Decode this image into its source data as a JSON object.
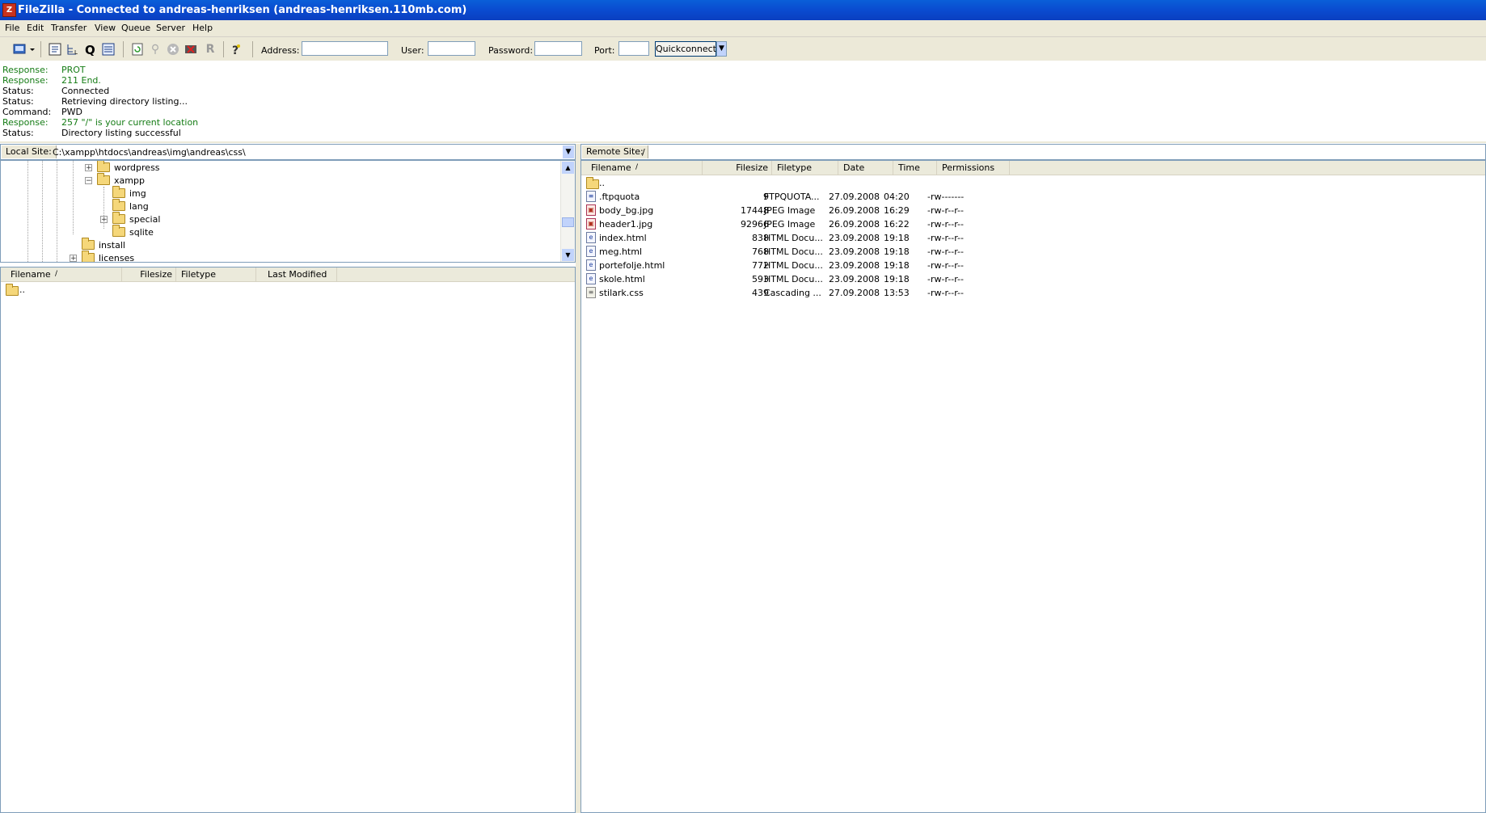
{
  "window": {
    "title": "FileZilla - Connected to andreas-henriksen (andreas-henriksen.110mb.com)",
    "app_icon": "Z"
  },
  "menu": [
    "File",
    "Edit",
    "Transfer",
    "View",
    "Queue",
    "Server",
    "Help"
  ],
  "quickconnect": {
    "address_label": "Address:",
    "address_value": "",
    "user_label": "User:",
    "user_value": "",
    "password_label": "Password:",
    "password_value": "",
    "port_label": "Port:",
    "port_value": "",
    "button_label": "Quickconnect"
  },
  "log": [
    {
      "label": "Response:",
      "message": "PROT",
      "color": "green"
    },
    {
      "label": "Response:",
      "message": "211 End.",
      "color": "green"
    },
    {
      "label": "Status:",
      "message": "Connected",
      "color": "black"
    },
    {
      "label": "Status:",
      "message": "Retrieving directory listing...",
      "color": "black"
    },
    {
      "label": "Command:",
      "message": "PWD",
      "color": "black"
    },
    {
      "label": "Response:",
      "message": "257 \"/\" is your current location",
      "color": "green"
    },
    {
      "label": "Status:",
      "message": "Directory listing successful",
      "color": "black"
    }
  ],
  "local": {
    "label": "Local Site:",
    "path": "C:\\xampp\\htdocs\\andreas\\img\\andreas\\css\\",
    "tree": [
      {
        "name": "wordpress",
        "expander": "+"
      },
      {
        "name": "xampp",
        "expander": "−"
      },
      {
        "name": "img",
        "expander": ""
      },
      {
        "name": "lang",
        "expander": ""
      },
      {
        "name": "special",
        "expander": "+"
      },
      {
        "name": "sqlite",
        "expander": ""
      },
      {
        "name": "install",
        "expander": ""
      },
      {
        "name": "licenses",
        "expander": "+"
      }
    ],
    "columns": [
      "Filename",
      "Filesize",
      "Filetype",
      "Last Modified"
    ],
    "sort_indicator": "/",
    "files": [
      {
        "name": ".."
      }
    ]
  },
  "remote": {
    "label": "Remote Site:",
    "path": "/",
    "columns": [
      "Filename",
      "Filesize",
      "Filetype",
      "Date",
      "Time",
      "Permissions"
    ],
    "sort_indicator": "/",
    "files": [
      {
        "name": "..",
        "size": "",
        "type": "",
        "date": "",
        "time": "",
        "perm": "",
        "icon": "folder"
      },
      {
        "name": ".ftpquota",
        "size": "9",
        "type": "FTPQUOTA...",
        "date": "27.09.2008",
        "time": "04:20",
        "perm": "-rw-------",
        "icon": "doc"
      },
      {
        "name": "body_bg.jpg",
        "size": "17448",
        "type": "JPEG Image",
        "date": "26.09.2008",
        "time": "16:29",
        "perm": "-rw-r--r--",
        "icon": "img"
      },
      {
        "name": "header1.jpg",
        "size": "92966",
        "type": "JPEG Image",
        "date": "26.09.2008",
        "time": "16:22",
        "perm": "-rw-r--r--",
        "icon": "img"
      },
      {
        "name": "index.html",
        "size": "838",
        "type": "HTML Docu...",
        "date": "23.09.2008",
        "time": "19:18",
        "perm": "-rw-r--r--",
        "icon": "html"
      },
      {
        "name": "meg.html",
        "size": "768",
        "type": "HTML Docu...",
        "date": "23.09.2008",
        "time": "19:18",
        "perm": "-rw-r--r--",
        "icon": "html"
      },
      {
        "name": "portefolje.html",
        "size": "772",
        "type": "HTML Docu...",
        "date": "23.09.2008",
        "time": "19:18",
        "perm": "-rw-r--r--",
        "icon": "html"
      },
      {
        "name": "skole.html",
        "size": "593",
        "type": "HTML Docu...",
        "date": "23.09.2008",
        "time": "19:18",
        "perm": "-rw-r--r--",
        "icon": "html"
      },
      {
        "name": "stilark.css",
        "size": "439",
        "type": "Cascading ...",
        "date": "27.09.2008",
        "time": "13:53",
        "perm": "-rw-r--r--",
        "icon": "css"
      }
    ]
  },
  "colors": {
    "titlebar": "#0a4bd0",
    "chrome": "#ece9d8",
    "log_green": "#157c15",
    "border": "#7f9db9"
  }
}
